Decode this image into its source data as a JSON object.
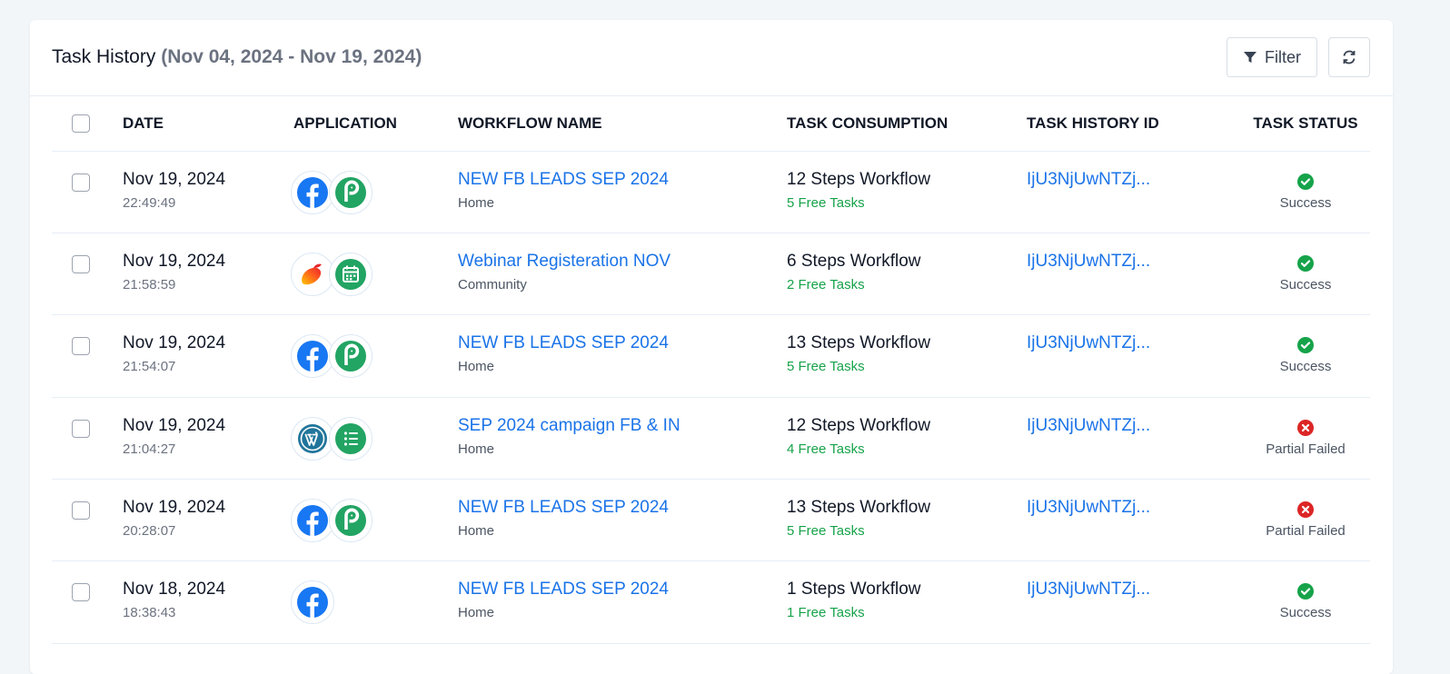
{
  "header": {
    "title": "Task History",
    "range": "(Nov 04, 2024 - Nov 19, 2024)",
    "filter_label": "Filter"
  },
  "columns": {
    "date": "DATE",
    "application": "APPLICATION",
    "workflow_name": "WORKFLOW NAME",
    "task_consumption": "TASK CONSUMPTION",
    "task_history_id": "TASK HISTORY ID",
    "task_status": "TASK STATUS"
  },
  "rows": [
    {
      "date": "Nov 19, 2024",
      "time": "22:49:49",
      "apps": [
        "facebook-icon",
        "pabbly-icon"
      ],
      "workflow": "NEW FB LEADS SEP 2024",
      "folder": "Home",
      "steps": "12 Steps Workflow",
      "free": "5 Free Tasks",
      "history_id": "IjU3NjUwNTZj...",
      "status": "Success",
      "status_type": "success"
    },
    {
      "date": "Nov 19, 2024",
      "time": "21:58:59",
      "apps": [
        "mango-icon",
        "calendar-icon"
      ],
      "workflow": "Webinar Registeration NOV",
      "folder": "Community",
      "steps": "6 Steps Workflow",
      "free": "2 Free Tasks",
      "history_id": "IjU3NjUwNTZj...",
      "status": "Success",
      "status_type": "success"
    },
    {
      "date": "Nov 19, 2024",
      "time": "21:54:07",
      "apps": [
        "facebook-icon",
        "pabbly-icon"
      ],
      "workflow": "NEW FB LEADS SEP 2024",
      "folder": "Home",
      "steps": "13 Steps Workflow",
      "free": "5 Free Tasks",
      "history_id": "IjU3NjUwNTZj...",
      "status": "Success",
      "status_type": "success"
    },
    {
      "date": "Nov 19, 2024",
      "time": "21:04:27",
      "apps": [
        "wordpress-icon",
        "form-list-icon"
      ],
      "workflow": "SEP 2024 campaign FB & IN",
      "folder": "Home",
      "steps": "12 Steps Workflow",
      "free": "4 Free Tasks",
      "history_id": "IjU3NjUwNTZj...",
      "status": "Partial Failed",
      "status_type": "failed"
    },
    {
      "date": "Nov 19, 2024",
      "time": "20:28:07",
      "apps": [
        "facebook-icon",
        "pabbly-icon"
      ],
      "workflow": "NEW FB LEADS SEP 2024",
      "folder": "Home",
      "steps": "13 Steps Workflow",
      "free": "5 Free Tasks",
      "history_id": "IjU3NjUwNTZj...",
      "status": "Partial Failed",
      "status_type": "failed"
    },
    {
      "date": "Nov 18, 2024",
      "time": "18:38:43",
      "apps": [
        "facebook-icon"
      ],
      "workflow": "NEW FB LEADS SEP 2024",
      "folder": "Home",
      "steps": "1 Steps Workflow",
      "free": "1 Free Tasks",
      "history_id": "IjU3NjUwNTZj...",
      "status": "Success",
      "status_type": "success"
    }
  ],
  "colors": {
    "link": "#1a73e8",
    "success": "#16a34a",
    "failed": "#dc2626",
    "facebook": "#1877f2",
    "pabbly": "#22a463"
  }
}
